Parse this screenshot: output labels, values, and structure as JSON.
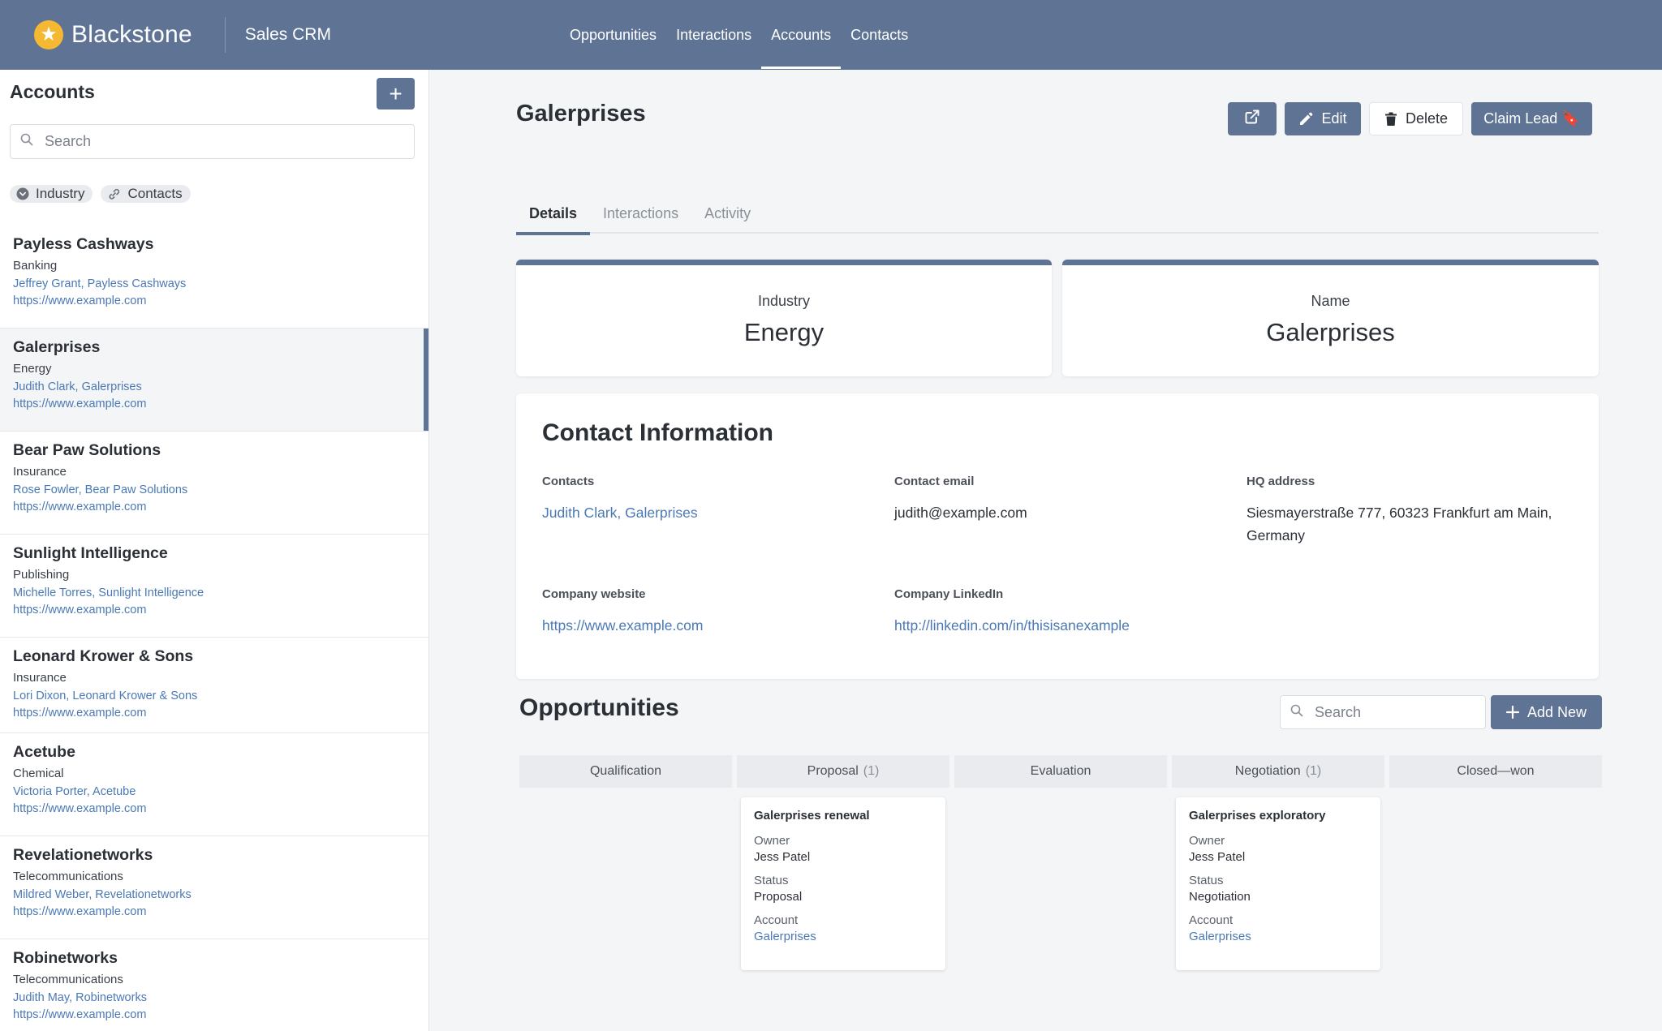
{
  "header": {
    "brand": "Blackstone",
    "app": "Sales CRM",
    "nav": [
      {
        "label": "Opportunities"
      },
      {
        "label": "Interactions"
      },
      {
        "label": "Accounts"
      },
      {
        "label": "Contacts"
      }
    ],
    "active_nav": "Accounts"
  },
  "sidebar": {
    "title": "Accounts",
    "add_label": "+",
    "search_placeholder": "Search",
    "chips": [
      {
        "label": "Industry",
        "icon": "chevron-down-circle-icon"
      },
      {
        "label": "Contacts",
        "icon": "link-icon"
      }
    ],
    "accounts": [
      {
        "name": "Payless Cashways",
        "industry": "Banking",
        "contact": "Jeffrey Grant, Payless Cashways",
        "website": "https://www.example.com"
      },
      {
        "name": "Galerprises",
        "industry": "Energy",
        "contact": "Judith Clark, Galerprises",
        "website": "https://www.example.com",
        "selected": true
      },
      {
        "name": "Bear Paw Solutions",
        "industry": "Insurance",
        "contact": "Rose Fowler, Bear Paw Solutions",
        "website": "https://www.example.com"
      },
      {
        "name": "Sunlight Intelligence",
        "industry": "Publishing",
        "contact": "Michelle Torres, Sunlight Intelligence",
        "website": "https://www.example.com"
      },
      {
        "name": "Leonard Krower & Sons",
        "industry": "Insurance",
        "contact": "Lori Dixon, Leonard Krower & Sons",
        "website": "https://www.example.com"
      },
      {
        "name": "Acetube",
        "industry": "Chemical",
        "contact": "Victoria Porter, Acetube",
        "website": "https://www.example.com"
      },
      {
        "name": "Revelationetworks",
        "industry": "Telecommunications",
        "contact": "Mildred Weber, Revelationetworks",
        "website": "https://www.example.com"
      },
      {
        "name": "Robinetworks",
        "industry": "Telecommunications",
        "contact": "Judith May, Robinetworks",
        "website": "https://www.example.com"
      }
    ]
  },
  "detail": {
    "title": "Galerprises",
    "actions": {
      "edit": "Edit",
      "delete": "Delete",
      "claim": "Claim Lead 🔖"
    },
    "tabs": [
      {
        "label": "Details"
      },
      {
        "label": "Interactions"
      },
      {
        "label": "Activity"
      }
    ],
    "active_tab": "Details",
    "stats": [
      {
        "label": "Industry",
        "value": "Energy"
      },
      {
        "label": "Name",
        "value": "Galerprises"
      }
    ],
    "contact_info": {
      "title": "Contact Information",
      "contacts_label": "Contacts",
      "contacts_value": "Judith Clark, Galerprises",
      "email_label": "Contact email",
      "email_value": "judith@example.com",
      "hq_label": "HQ address",
      "hq_value": "Siesmayerstraße 777, 60323 Frankfurt am Main, Germany",
      "website_label": "Company website",
      "website_value": "https://www.example.com",
      "linkedin_label": "Company LinkedIn",
      "linkedin_value": "http://linkedin.com/in/thisisanexample"
    }
  },
  "opportunities": {
    "title": "Opportunities",
    "search_placeholder": "Search",
    "add_label": "Add New",
    "columns": [
      {
        "label": "Qualification",
        "count": ""
      },
      {
        "label": "Proposal",
        "count": "(1)"
      },
      {
        "label": "Evaluation",
        "count": ""
      },
      {
        "label": "Negotiation",
        "count": "(1)"
      },
      {
        "label": "Closed—won",
        "count": ""
      }
    ],
    "cards": {
      "proposal": {
        "name": "Galerprises renewal",
        "owner_label": "Owner",
        "owner": "Jess Patel",
        "status_label": "Status",
        "status": "Proposal",
        "account_label": "Account",
        "account": "Galerprises"
      },
      "negotiation": {
        "name": "Galerprises exploratory",
        "owner_label": "Owner",
        "owner": "Jess Patel",
        "status_label": "Status",
        "status": "Negotiation",
        "account_label": "Account",
        "account": "Galerprises"
      }
    }
  },
  "colors": {
    "primary": "#5f7394",
    "brand_star": "#f5b833",
    "link": "#4a79b4"
  }
}
